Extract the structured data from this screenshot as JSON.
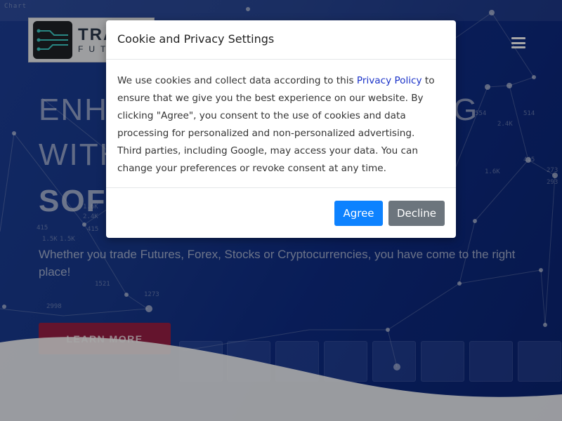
{
  "page": {
    "chart_strip_text": "Chart",
    "logo": {
      "text_big": "TRA",
      "text_small": "FUT"
    },
    "menu_icon": "hamburger-menu-icon",
    "hero": {
      "headline_line1": "ENHA",
      "headline_line1_end": "G",
      "headline_line2": "WITH",
      "headline_line3": "SOFT",
      "subtext": "Whether you trade Futures, Forex, Stocks or Cryptocurrencies, you have come to the right place!",
      "cta_label": "LEARN MORE"
    },
    "bg_numbers": [
      "415",
      "1.5K",
      "1.5K",
      "2.4K",
      "1521",
      "1273",
      "2998",
      "415",
      "1.6K",
      "514",
      "554",
      "2.4K",
      "273",
      "293",
      "415",
      "1.6K"
    ]
  },
  "colors": {
    "hero_bg": "#17398f",
    "cta": "#9a1f45",
    "agree": "#0d82ff",
    "decline": "#6c757d"
  },
  "cookie_modal": {
    "title": "Cookie and Privacy Settings",
    "body_before_link": "We use cookies and collect data according to this ",
    "link_text": "Privacy Policy",
    "body_after_link": " to ensure that we give you the best experience on our website. By clicking \"Agree\", you consent to the use of cookies and data processing for personalized and non-personalized advertising.",
    "body_paragraph2": "Third parties, including Google, may access your data. You can change your preferences or revoke consent at any time.",
    "agree_label": "Agree",
    "decline_label": "Decline"
  }
}
